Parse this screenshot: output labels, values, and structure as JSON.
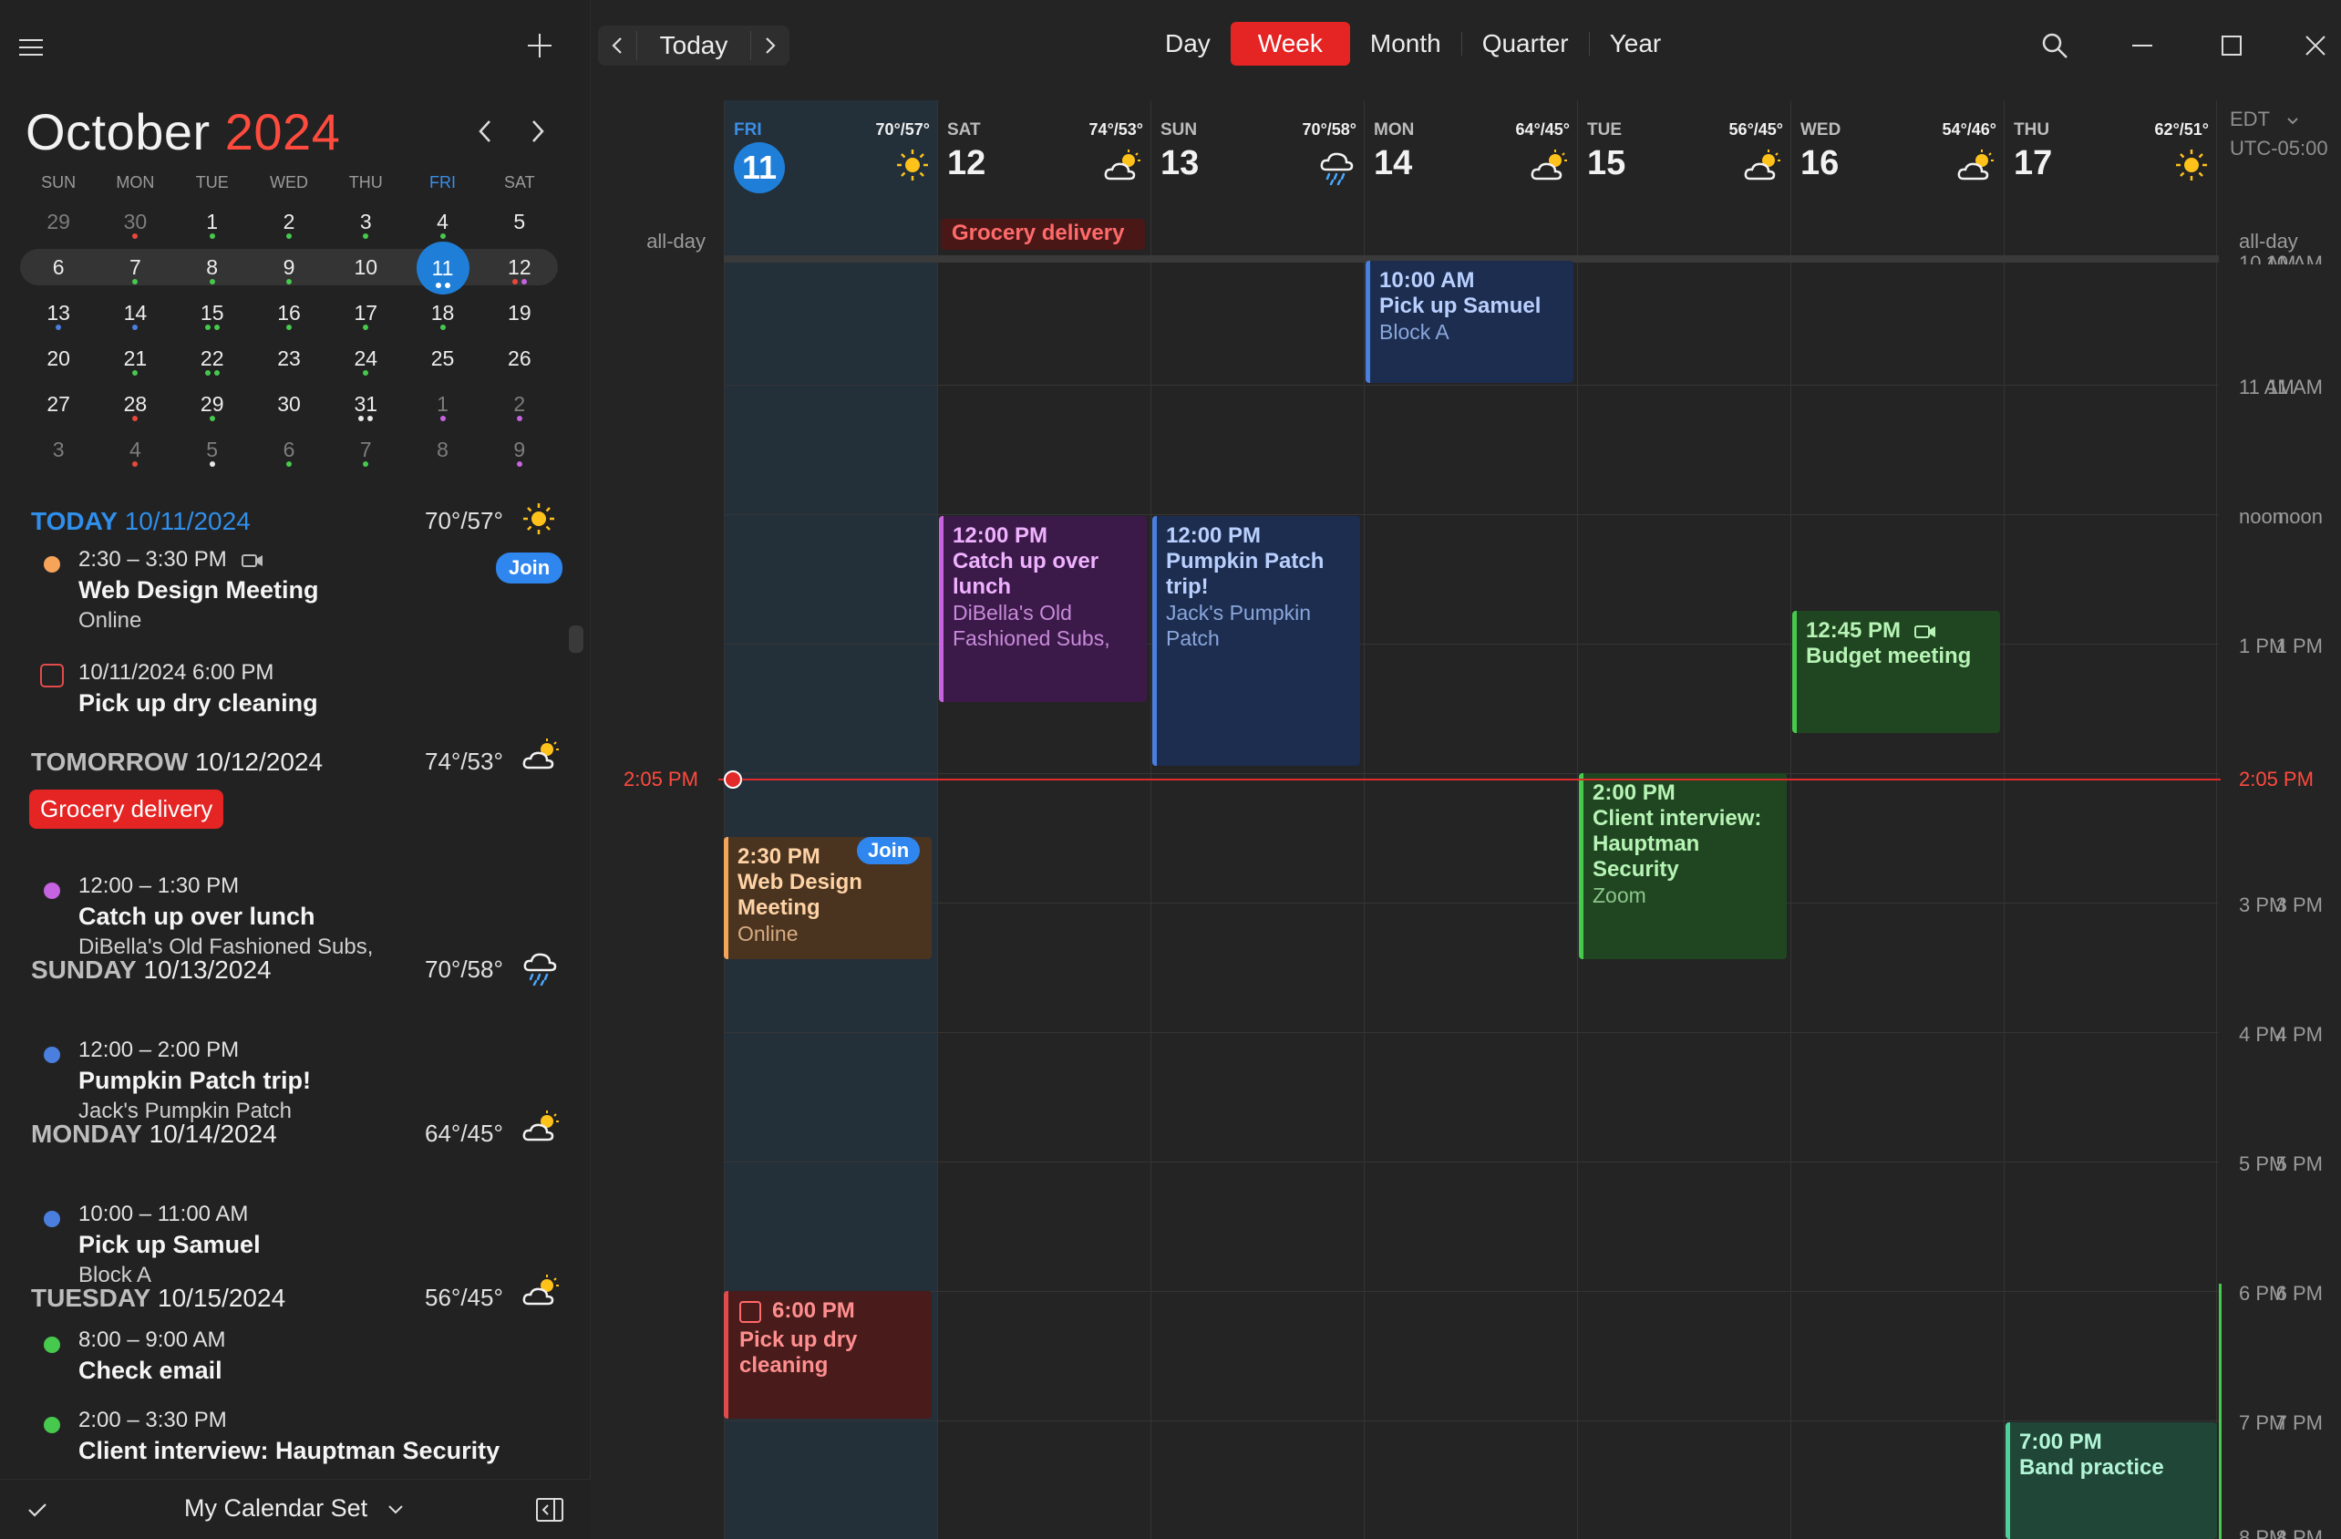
{
  "header": {
    "today_label": "Today"
  },
  "views": [
    {
      "label": "Day",
      "active": false
    },
    {
      "label": "Week",
      "active": true
    },
    {
      "label": "Month",
      "active": false
    },
    {
      "label": "Quarter",
      "active": false
    },
    {
      "label": "Year",
      "active": false
    }
  ],
  "mini_calendar": {
    "month": "October",
    "year": "2024",
    "dow": [
      "SUN",
      "MON",
      "TUE",
      "WED",
      "THU",
      "FRI",
      "SAT"
    ],
    "weeks": [
      [
        "29",
        "30",
        "1",
        "2",
        "3",
        "4",
        "5"
      ],
      [
        "6",
        "7",
        "8",
        "9",
        "10",
        "11",
        "12"
      ],
      [
        "13",
        "14",
        "15",
        "16",
        "17",
        "18",
        "19"
      ],
      [
        "20",
        "21",
        "22",
        "23",
        "24",
        "25",
        "26"
      ],
      [
        "27",
        "28",
        "29",
        "30",
        "31",
        "1",
        "2"
      ],
      [
        "3",
        "4",
        "5",
        "6",
        "7",
        "8",
        "9"
      ]
    ]
  },
  "agenda": {
    "today": {
      "label": "TODAY",
      "date": "10/11/2024",
      "temp": "70°/57°"
    },
    "web_design": {
      "time": "2:30 – 3:30 PM",
      "title": "Web Design Meeting",
      "location": "Online",
      "join": "Join"
    },
    "dry_cleaning": {
      "time": "10/11/2024 6:00 PM",
      "title": "Pick up dry cleaning"
    },
    "tomorrow": {
      "label": "TOMORROW",
      "date": "10/12/2024",
      "temp": "74°/53°"
    },
    "grocery": "Grocery delivery",
    "lunch": {
      "time": "12:00 – 1:30 PM",
      "title": "Catch up over lunch",
      "location": "DiBella's Old Fashioned Subs,"
    },
    "sunday": {
      "label": "SUNDAY",
      "date": "10/13/2024",
      "temp": "70°/58°"
    },
    "pumpkin": {
      "time": "12:00 – 2:00 PM",
      "title": "Pumpkin Patch trip!",
      "location": "Jack's Pumpkin Patch"
    },
    "monday": {
      "label": "MONDAY",
      "date": "10/14/2024",
      "temp": "64°/45°"
    },
    "samuel": {
      "time": "10:00 – 11:00 AM",
      "title": "Pick up Samuel",
      "location": "Block A"
    },
    "tuesday": {
      "label": "TUESDAY",
      "date": "10/15/2024",
      "temp": "56°/45°"
    },
    "email": {
      "time": "8:00 – 9:00 AM",
      "title": "Check email"
    },
    "interview": {
      "time": "2:00 – 3:30 PM",
      "title": "Client interview: Hauptman Security"
    }
  },
  "footer": {
    "calendar_set": "My Calendar Set"
  },
  "week": {
    "days": [
      {
        "dow": "FRI",
        "num": "11",
        "temp": "70°/57°",
        "icon": "sun-icon"
      },
      {
        "dow": "SAT",
        "num": "12",
        "temp": "74°/53°",
        "icon": "partly-cloudy-icon"
      },
      {
        "dow": "SUN",
        "num": "13",
        "temp": "70°/58°",
        "icon": "rain-icon"
      },
      {
        "dow": "MON",
        "num": "14",
        "temp": "64°/45°",
        "icon": "partly-cloudy-icon"
      },
      {
        "dow": "TUE",
        "num": "15",
        "temp": "56°/45°",
        "icon": "partly-cloudy-icon"
      },
      {
        "dow": "WED",
        "num": "16",
        "temp": "54°/46°",
        "icon": "partly-cloudy-icon"
      },
      {
        "dow": "THU",
        "num": "17",
        "temp": "62°/51°",
        "icon": "sun-icon"
      }
    ],
    "timezone": "EDT",
    "utc": "UTC-05:00",
    "all_day": "all-day",
    "hours": [
      "10 AM",
      "11 AM",
      "noon",
      "1 PM",
      "3 PM",
      "4 PM",
      "5 PM",
      "6 PM",
      "7 PM",
      "8 PM"
    ],
    "now": "2:05 PM",
    "allday_event": "Grocery delivery",
    "events": {
      "samuel": {
        "time": "10:00 AM",
        "title": "Pick up Samuel",
        "loc": "Block A"
      },
      "lunch": {
        "time": "12:00 PM",
        "title": "Catch up over lunch",
        "loc": "DiBella's Old Fashioned Subs,"
      },
      "pumpkin": {
        "time": "12:00 PM",
        "title": "Pumpkin Patch trip!",
        "loc": "Jack's Pumpkin Patch"
      },
      "budget": {
        "time": "12:45 PM",
        "title": "Budget meeting"
      },
      "interview": {
        "time": "2:00 PM",
        "title": "Client interview: Hauptman Security",
        "loc": "Zoom"
      },
      "web": {
        "time": "2:30 PM",
        "title": "Web Design Meeting",
        "loc": "Online",
        "join": "Join"
      },
      "dry": {
        "time": "6:00 PM",
        "title": "Pick up dry cleaning"
      },
      "band": {
        "time": "7:00 PM",
        "title": "Band practice"
      }
    }
  },
  "colors": {
    "accent": "#e52424",
    "today_blue": "#1f7fd8",
    "now_red": "#e22a2a"
  }
}
